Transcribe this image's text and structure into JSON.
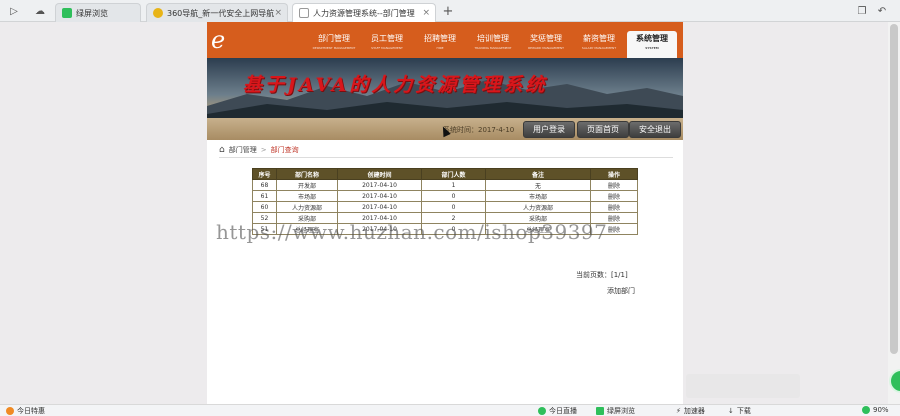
{
  "browser": {
    "tabs": [
      {
        "label": "绿屏浏览",
        "active": false
      },
      {
        "label": "360导航_新一代安全上网导航",
        "active": false
      },
      {
        "label": "人力资源管理系统--部门管理",
        "active": true
      }
    ],
    "new_tab": "+"
  },
  "nav": {
    "logo": "e",
    "items": [
      {
        "label": "部门管理",
        "sub": "DEPARTMENT MANAGEMENT"
      },
      {
        "label": "员工管理",
        "sub": "STAFF MANAGEMENT"
      },
      {
        "label": "招聘管理",
        "sub": "HIRE"
      },
      {
        "label": "培训管理",
        "sub": "TRAINING MANAGEMENT"
      },
      {
        "label": "奖惩管理",
        "sub": "REWARD MANAGEMENT"
      },
      {
        "label": "薪资管理",
        "sub": "SALARY MANAGEMENT"
      },
      {
        "label": "系统管理",
        "sub": "SYSTEM"
      }
    ],
    "active_index": 6
  },
  "banner": {
    "title": "基于JAVA的人力资源管理系统"
  },
  "infobar": {
    "system_time": "系统时间：2017-4-10",
    "buttons": [
      "用户登录",
      "页面首页",
      "安全退出"
    ]
  },
  "breadcrumb": {
    "root": "部门管理",
    "separator": ">",
    "current": "部门查询"
  },
  "table": {
    "headers": [
      "序号",
      "部门名称",
      "创建时间",
      "部门人数",
      "备注",
      "操作"
    ],
    "rows": [
      [
        "68",
        "开发部",
        "2017-04-10",
        "1",
        "无",
        "删除"
      ],
      [
        "61",
        "市场部",
        "2017-04-10",
        "0",
        "市场部",
        "删除"
      ],
      [
        "60",
        "人力资源部",
        "2017-04-10",
        "0",
        "人力资源部",
        "删除"
      ],
      [
        "52",
        "采购部",
        "2017-04-10",
        "2",
        "采购部",
        "删除"
      ],
      [
        "51",
        "总经理室",
        "2017-04-10",
        "0",
        "总经理室",
        "删除"
      ]
    ]
  },
  "pagination": {
    "text": "当前页数：[1/1]"
  },
  "add_link": "添加部门",
  "watermark": "https://www.huzhan.com/ishop39397",
  "statusbar": {
    "left": "今日特惠",
    "items": [
      "今日直播",
      "绿屏浏览",
      "加速器",
      "下载"
    ],
    "zoom": "90%"
  },
  "colors": {
    "nav": "#d65d1d",
    "table_header": "#5e5128",
    "title_red": "#d8161b"
  }
}
